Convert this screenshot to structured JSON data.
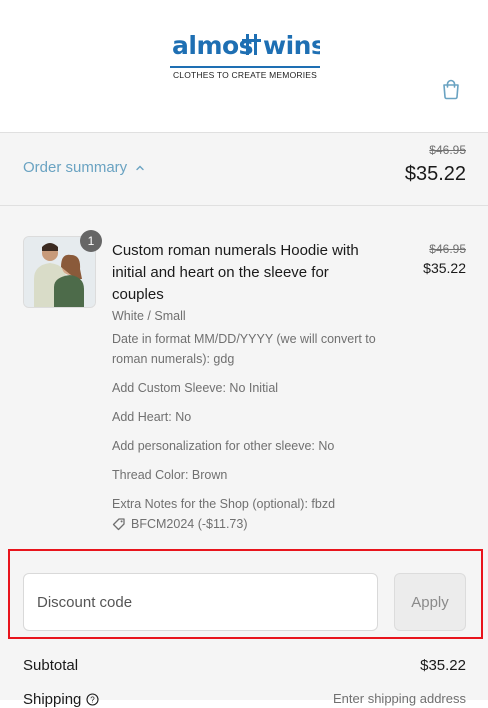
{
  "brand": {
    "logo_text": "almosttwins",
    "tagline": "CLOTHES TO CREATE MEMORIES",
    "accent_color": "#1e6fb3"
  },
  "header": {
    "cart_icon": "shopping-bag-icon"
  },
  "summary": {
    "toggle_label": "Order summary",
    "original_total": "$46.95",
    "total": "$35.22",
    "toggle_color": "#6aa3c2"
  },
  "item": {
    "quantity": "1",
    "title": "Custom roman numerals Hoodie with initial and heart on the sleeve for couples",
    "variant": "White / Small",
    "original_price": "$46.95",
    "price": "$35.22",
    "properties": [
      "Date in format MM/DD/YYYY (we will convert to roman numerals): gdg",
      "Add Custom Sleeve: No Initial",
      "Add Heart: No",
      "Add personalization for other sleeve: No",
      "Thread Color: Brown",
      "Extra Notes for the Shop (optional): fbzd"
    ],
    "discount_label": "BFCM2024 (-$11.73)"
  },
  "discount": {
    "placeholder": "Discount code",
    "apply_label": "Apply"
  },
  "totals": {
    "subtotal_label": "Subtotal",
    "subtotal_value": "$35.22",
    "shipping_label": "Shipping",
    "shipping_value": "Enter shipping address"
  }
}
